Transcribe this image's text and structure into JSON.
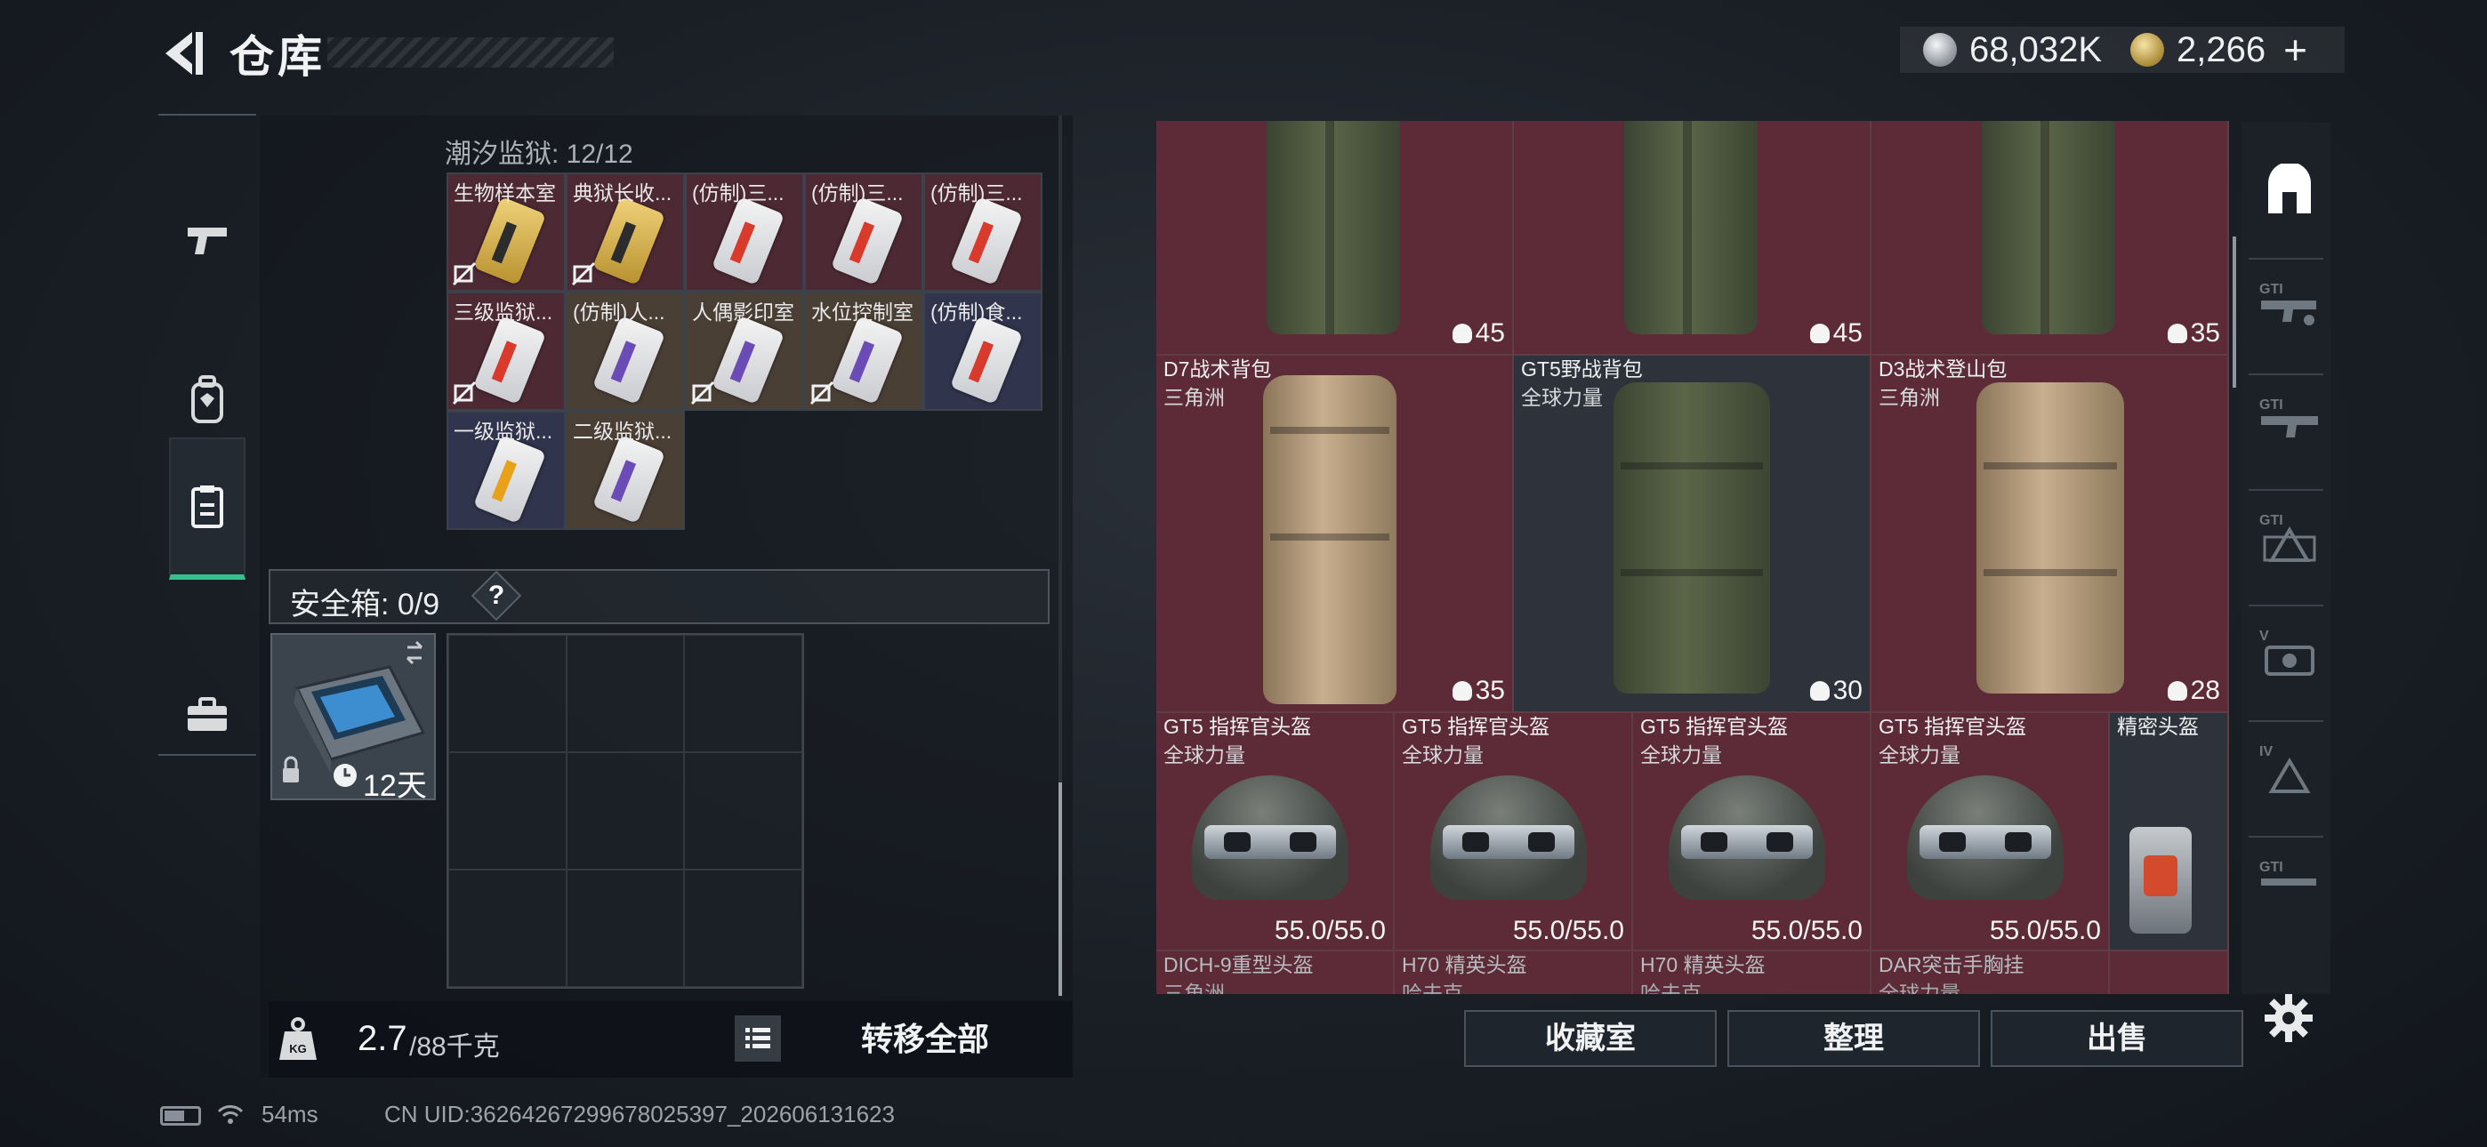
{
  "header": {
    "title": "仓库"
  },
  "currency": {
    "silver": "68,032K",
    "gold": "2,266",
    "plus": "+"
  },
  "sidebar": {
    "items": [
      "pistol-icon",
      "backpack-icon",
      "keycard-icon",
      "toolbox-icon"
    ],
    "active_index": 2
  },
  "prison": {
    "label": "潮汐监狱: 12/12",
    "keys": [
      {
        "name": "生物样本室",
        "color": "red",
        "card": "gold",
        "locked": true
      },
      {
        "name": "典狱长收...",
        "color": "red",
        "card": "gold",
        "locked": true
      },
      {
        "name": "(仿制)三...",
        "color": "red",
        "card": "white",
        "stripe": "#d83a2c",
        "locked": false
      },
      {
        "name": "(仿制)三...",
        "color": "red",
        "card": "white",
        "stripe": "#d83a2c",
        "locked": false
      },
      {
        "name": "(仿制)三...",
        "color": "red",
        "card": "white",
        "stripe": "#d83a2c",
        "locked": false
      },
      {
        "name": "三级监狱...",
        "color": "red",
        "card": "white",
        "stripe": "#d83a2c",
        "locked": true
      },
      {
        "name": "(仿制)人...",
        "color": "tan",
        "card": "white",
        "stripe": "#6b4bb5",
        "locked": false
      },
      {
        "name": "人偶影印室",
        "color": "tan",
        "card": "white",
        "stripe": "#6b4bb5",
        "locked": true
      },
      {
        "name": "水位控制室",
        "color": "tan",
        "card": "white",
        "stripe": "#6b4bb5",
        "locked": true
      },
      {
        "name": "(仿制)食...",
        "color": "blue",
        "card": "white",
        "stripe": "#d83a2c",
        "locked": false
      },
      {
        "name": "一级监狱...",
        "color": "blue",
        "card": "white",
        "stripe": "#e8a21a",
        "locked": false
      },
      {
        "name": "二级监狱...",
        "color": "tan",
        "card": "white",
        "stripe": "#6b4bb5",
        "locked": false
      }
    ]
  },
  "safe": {
    "label": "安全箱: 0/9",
    "help": "?",
    "days": "12天"
  },
  "weight": {
    "current": "2.7",
    "capacity": "/88千克"
  },
  "actions": {
    "transfer_all": "转移全部",
    "collection": "收藏室",
    "sort": "整理",
    "sell": "出售"
  },
  "backpacks_top": [
    {
      "capacity": "45"
    },
    {
      "capacity": "45"
    },
    {
      "capacity": "35"
    }
  ],
  "backpacks": [
    {
      "name": "D7战术背包",
      "source": "三角洲",
      "capacity": "35",
      "style": "tan"
    },
    {
      "name": "GT5野战背包",
      "source": "全球力量",
      "capacity": "30",
      "style": "olive"
    },
    {
      "name": "D3战术登山包",
      "source": "三角洲",
      "capacity": "28",
      "style": "tan"
    }
  ],
  "helmets": [
    {
      "name": "GT5 指挥官头盔",
      "source": "全球力量",
      "durability": "55.0/55.0"
    },
    {
      "name": "GT5 指挥官头盔",
      "source": "全球力量",
      "durability": "55.0/55.0"
    },
    {
      "name": "GT5 指挥官头盔",
      "source": "全球力量",
      "durability": "55.0/55.0"
    },
    {
      "name": "GT5 指挥官头盔",
      "source": "全球力量",
      "durability": "55.0/55.0"
    }
  ],
  "precision_helmet": {
    "name": "精密头盔"
  },
  "bottom_row": [
    {
      "name": "DICH-9重型头盔",
      "source": "三角洲"
    },
    {
      "name": "H70 精英头盔",
      "source": "哈夫克"
    },
    {
      "name": "H70 精英头盔",
      "source": "哈夫克"
    },
    {
      "name": "DAR突击手胸挂",
      "source": "全球力量"
    }
  ],
  "categories": [
    "backpack-category-icon",
    "gt-rifle-icon",
    "gt-smg-icon",
    "gt-armor-icon",
    "v-armor-icon",
    "iv-armor-icon",
    "gt-rifle-2-icon"
  ],
  "status": {
    "ping": "54ms",
    "uid": "CN UID:36264267299678025397_202606131623"
  },
  "colors": {
    "accent": "#35c08e",
    "cell_red": "#5c2b37",
    "cell_tan": "#4a3f35",
    "cell_blue": "#30344c"
  }
}
